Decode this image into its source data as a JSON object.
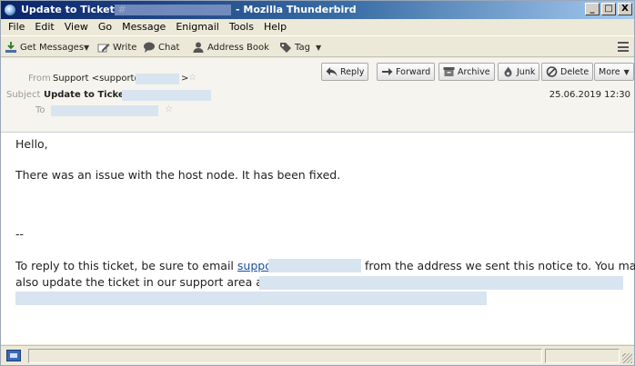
{
  "window": {
    "title_prefix": "Update to Ticket #",
    "title_app": "- Mozilla Thunderbird",
    "controls": [
      "_",
      "□",
      "X"
    ]
  },
  "menubar": {
    "items": [
      "File",
      "Edit",
      "View",
      "Go",
      "Message",
      "Enigmail",
      "Tools",
      "Help"
    ]
  },
  "toolbar": {
    "get_messages": "Get Messages",
    "write": "Write",
    "chat": "Chat",
    "address_book": "Address Book",
    "tag": "Tag"
  },
  "header": {
    "from_label": "From",
    "from_value": "Support <support@",
    "from_value_end": ">",
    "subject_label": "Subject",
    "subject_value": "Update to Ticket",
    "to_label": "To",
    "date": "25.06.2019 12:30",
    "buttons": {
      "reply": "Reply",
      "forward": "Forward",
      "archive": "Archive",
      "junk": "Junk",
      "delete": "Delete",
      "more": "More"
    }
  },
  "body": {
    "greeting": "Hello,",
    "message": "There was an issue with the host node. It has been fixed.",
    "separator": "--",
    "reply_text_1": "To reply to this ticket, be sure to email",
    "reply_link": "support",
    "reply_text_2": "from the address we sent this notice to. You may",
    "reply_text_3": "also update the ticket in our support area at"
  },
  "colors": {
    "titlebar_start": "#0a246a",
    "titlebar_end": "#a6caf0",
    "link": "#1a4fa3",
    "redaction": "#d9e4f1"
  }
}
